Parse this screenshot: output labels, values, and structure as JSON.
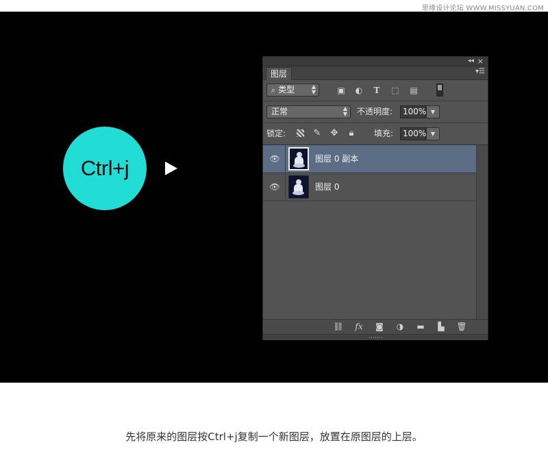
{
  "watermark": "思缘设计论坛 WWW.MISSYUAN.COM",
  "shortcut_label": "Ctrl+j",
  "panel": {
    "tab_label": "图层",
    "filter": {
      "label": "类型",
      "search_glyph": "⌕"
    },
    "filter_icons": [
      "image-filter-icon",
      "adjustment-filter-icon",
      "type-filter-icon",
      "shape-filter-icon",
      "smart-object-filter-icon"
    ],
    "blend_mode": "正常",
    "opacity_label": "不透明度:",
    "opacity_value": "100%",
    "lock_label": "锁定:",
    "fill_label": "填充:",
    "fill_value": "100%",
    "layers": [
      {
        "name": "图层 0 副本",
        "selected": true,
        "visible": true
      },
      {
        "name": "图层 0",
        "selected": false,
        "visible": true
      }
    ],
    "bottom_icons": [
      "link-layers-icon",
      "fx-icon",
      "mask-icon",
      "adjustment-layer-icon",
      "group-folder-icon",
      "new-layer-icon",
      "trash-icon"
    ],
    "fx_text": "fx"
  },
  "colors": {
    "circle": "#22dcd6",
    "selected_layer": "#5c6d86",
    "panel_bg": "#535353"
  },
  "caption": "先将原来的图层按Ctrl+j复制一个新图层，放置在原图层的上层。"
}
